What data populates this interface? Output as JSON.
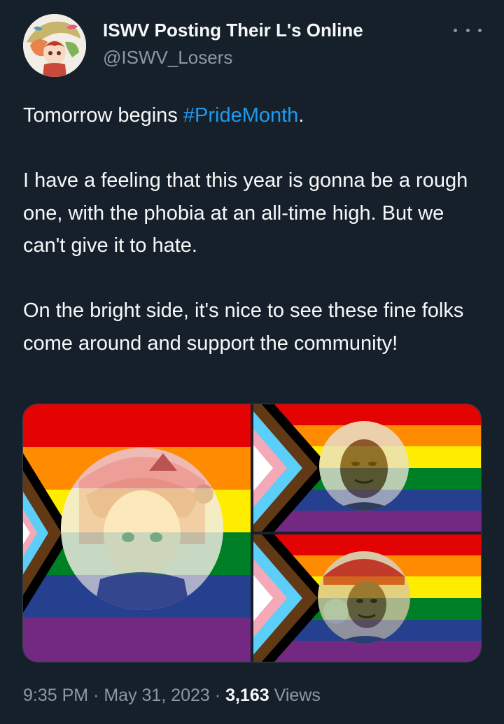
{
  "author": {
    "display_name": "ISWV Posting Their L's Online",
    "handle": "@ISWV_Losers"
  },
  "tweet": {
    "line1_before": "Tomorrow begins ",
    "hashtag": "#PrideMonth",
    "line1_after": ".",
    "paragraph2": "I have a feeling that this year is gonna be a rough one, with the phobia at an all-time high.  But we can't give it to hate.",
    "paragraph3": "On the bright side, it's nice to see these fine folks come around and support the community!"
  },
  "media": {
    "images": [
      {
        "subject": "anime-girl-avatar"
      },
      {
        "subject": "man-portrait"
      },
      {
        "subject": "man-in-cap-portrait"
      }
    ],
    "flag_colors": [
      "#e40303",
      "#ff8c00",
      "#ffed00",
      "#008026",
      "#24408e",
      "#732982"
    ],
    "chevron_colors": [
      "#ffffff",
      "#f5a9b8",
      "#5bcefa",
      "#613915",
      "#000000"
    ]
  },
  "meta": {
    "time": "9:35 PM",
    "date": "May 31, 2023",
    "separator": "·",
    "views_count": "3,163",
    "views_label": "Views"
  }
}
